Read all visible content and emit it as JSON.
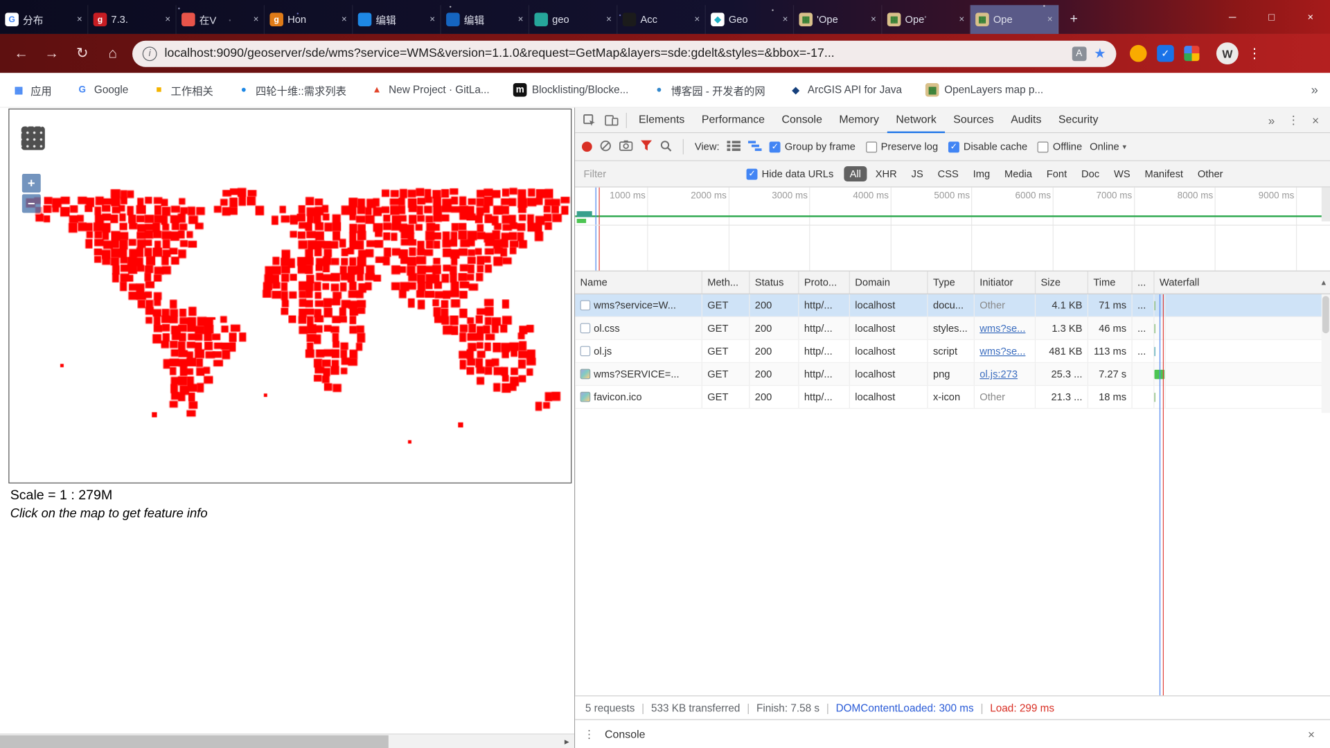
{
  "icons": {
    "back": "←",
    "forward": "→",
    "reload": "↻",
    "home": "⌂",
    "info": "i",
    "translate": "A",
    "star": "★",
    "menu": "⋮",
    "caret": "▾",
    "arrow_right": "▸"
  },
  "window": {
    "tabs": [
      {
        "title": "分布",
        "icon": {
          "name": "google-favicon",
          "bg": "#ffffff",
          "fg": "#4285F4",
          "char": "G"
        },
        "close": "×"
      },
      {
        "title": "7.3.",
        "icon": {
          "name": "gitee-favicon",
          "bg": "#c71d23",
          "fg": "#ffffff",
          "char": "g"
        },
        "close": "×"
      },
      {
        "title": "在V",
        "icon": {
          "name": "site-favicon",
          "bg": "#e8544a",
          "fg": "#ffffff",
          "char": ""
        },
        "close": "×"
      },
      {
        "title": "Hon",
        "icon": {
          "name": "git-favicon",
          "bg": "#df7b18",
          "fg": "#ffffff",
          "char": "g"
        },
        "close": "×"
      },
      {
        "title": "编辑",
        "icon": {
          "name": "editor-favicon",
          "bg": "#1e88e5",
          "fg": "#ffffff",
          "char": ""
        },
        "close": "×"
      },
      {
        "title": "编辑",
        "icon": {
          "name": "editor-favicon",
          "bg": "#1565c0",
          "fg": "#ffffff",
          "char": ""
        },
        "close": "×"
      },
      {
        "title": "geo",
        "icon": {
          "name": "geo-favicon",
          "bg": "#26a69a",
          "fg": "#ffffff",
          "char": ""
        },
        "close": "×"
      },
      {
        "title": "Acc",
        "icon": {
          "name": "dark-favicon",
          "bg": "#1b1b1b",
          "fg": "#ffffff",
          "char": ""
        },
        "close": "×"
      },
      {
        "title": "Geo",
        "icon": {
          "name": "geoserver-favicon",
          "bg": "#ffffff",
          "fg": "#1fb0c4",
          "char": "◆"
        },
        "close": "×"
      },
      {
        "title": "'Ope",
        "icon": {
          "name": "openlayers-favicon",
          "bg": "#d9c08a",
          "fg": "#2e7d32",
          "char": "▦"
        },
        "close": "×"
      },
      {
        "title": "Ope",
        "icon": {
          "name": "openlayers-favicon",
          "bg": "#d9c08a",
          "fg": "#2e7d32",
          "char": "▦"
        },
        "close": "×"
      },
      {
        "title": "Ope",
        "icon": {
          "name": "openlayers-favicon",
          "bg": "#d9c08a",
          "fg": "#2e7d32",
          "char": "▦"
        },
        "active": true,
        "close": "×"
      }
    ],
    "new_tab": "+",
    "minimize": "─",
    "maximize": "□",
    "close": "×"
  },
  "toolbar": {
    "url": "localhost:9090/geoserver/sde/wms?service=WMS&version=1.1.0&request=GetMap&layers=sde:gdelt&styles=&bbox=-17...",
    "profile_initial": "W"
  },
  "bookmarks": {
    "items": [
      {
        "label": "应用",
        "icon": {
          "name": "apps-grid-icon",
          "bg": "#ffffff",
          "fg": "#4285F4",
          "char": "▦"
        }
      },
      {
        "label": "Google",
        "icon": {
          "name": "google-icon",
          "bg": "#ffffff",
          "fg": "#4285F4",
          "char": "G"
        }
      },
      {
        "label": "工作相关",
        "icon": {
          "name": "folder-icon",
          "bg": "#ffffff",
          "fg": "#f4b400",
          "char": "■"
        }
      },
      {
        "label": "四轮十维::需求列表",
        "icon": {
          "name": "site-icon",
          "bg": "#ffffff",
          "fg": "#1e88e5",
          "char": "●"
        }
      },
      {
        "label": "New Project · GitLa...",
        "icon": {
          "name": "gitlab-icon",
          "bg": "#ffffff",
          "fg": "#e24329",
          "char": "▲"
        }
      },
      {
        "label": "Blocklisting/Blocke...",
        "icon": {
          "name": "m-icon",
          "bg": "#111111",
          "fg": "#ffffff",
          "char": "m"
        }
      },
      {
        "label": "博客园 - 开发者的网",
        "icon": {
          "name": "cnblogs-icon",
          "bg": "#ffffff",
          "fg": "#3388cc",
          "char": "●"
        }
      },
      {
        "label": "ArcGIS API for Java",
        "icon": {
          "name": "arcgis-icon",
          "bg": "#ffffff",
          "fg": "#16407c",
          "char": "◆"
        }
      },
      {
        "label": "OpenLayers map p...",
        "icon": {
          "name": "openlayers-icon",
          "bg": "#d9c08a",
          "fg": "#2e7d32",
          "char": "▦"
        }
      }
    ],
    "overflow": "»"
  },
  "map": {
    "zoom_in": "+",
    "zoom_out": "−",
    "scale_text": "Scale = 1 : 279M",
    "hint_text": "Click on the map to get feature info",
    "point_color": "#ff0000",
    "land_rows": [
      [
        [
          12,
          14
        ],
        [
          23,
          28
        ],
        [
          44,
          52
        ],
        [
          55,
          63
        ]
      ],
      [
        [
          2,
          6
        ],
        [
          8,
          20
        ],
        [
          23,
          28
        ],
        [
          33,
          36
        ],
        [
          40,
          65
        ]
      ],
      [
        [
          2,
          7
        ],
        [
          9,
          22
        ],
        [
          24,
          27
        ],
        [
          29,
          29
        ],
        [
          32,
          37
        ],
        [
          39,
          65
        ]
      ],
      [
        [
          3,
          8
        ],
        [
          9,
          21
        ],
        [
          31,
          32
        ],
        [
          33,
          38
        ],
        [
          40,
          64
        ]
      ],
      [
        [
          7,
          22
        ],
        [
          31,
          32
        ],
        [
          34,
          38
        ],
        [
          40,
          63
        ]
      ],
      [
        [
          8,
          21
        ],
        [
          33,
          44
        ],
        [
          45,
          62
        ]
      ],
      [
        [
          9,
          21
        ],
        [
          33,
          43
        ],
        [
          45,
          60
        ]
      ],
      [
        [
          10,
          20
        ],
        [
          32,
          42
        ],
        [
          44,
          59
        ]
      ],
      [
        [
          10,
          19
        ],
        [
          31,
          41
        ],
        [
          43,
          58
        ]
      ],
      [
        [
          11,
          18
        ],
        [
          30,
          42
        ],
        [
          44,
          56
        ]
      ],
      [
        [
          12,
          17
        ],
        [
          30,
          43
        ],
        [
          45,
          55
        ]
      ],
      [
        [
          13,
          17
        ],
        [
          30,
          42
        ],
        [
          45,
          50
        ],
        [
          51,
          54
        ]
      ],
      [
        [
          14,
          18
        ],
        [
          30,
          41
        ],
        [
          46,
          49
        ],
        [
          50,
          53
        ]
      ],
      [
        [
          15,
          19
        ],
        [
          31,
          41
        ],
        [
          46,
          48
        ],
        [
          50,
          52
        ],
        [
          56,
          58
        ]
      ],
      [
        [
          16,
          22
        ],
        [
          32,
          41
        ],
        [
          47,
          48
        ],
        [
          50,
          53
        ],
        [
          55,
          57
        ]
      ],
      [
        [
          16,
          25
        ],
        [
          33,
          41
        ],
        [
          50,
          52
        ],
        [
          54,
          58
        ]
      ],
      [
        [
          17,
          26
        ],
        [
          34,
          41
        ],
        [
          51,
          58
        ],
        [
          60,
          61
        ]
      ],
      [
        [
          17,
          27
        ],
        [
          34,
          41
        ],
        [
          53,
          56
        ],
        [
          59,
          60
        ]
      ],
      [
        [
          18,
          26
        ],
        [
          35,
          41
        ],
        [
          54,
          60
        ]
      ],
      [
        [
          18,
          25
        ],
        [
          35,
          40
        ],
        [
          53,
          61
        ]
      ],
      [
        [
          18,
          24
        ],
        [
          36,
          40
        ],
        [
          53,
          61
        ]
      ],
      [
        [
          19,
          23
        ],
        [
          36,
          39
        ],
        [
          54,
          61
        ]
      ],
      [
        [
          19,
          23
        ],
        [
          36,
          38
        ],
        [
          55,
          60
        ]
      ],
      [
        [
          19,
          22
        ],
        [
          37,
          38
        ],
        [
          57,
          59
        ]
      ],
      [
        [
          19,
          21
        ],
        [
          63,
          64
        ]
      ],
      [
        [
          19,
          21
        ],
        [
          62,
          63
        ]
      ],
      [
        [
          20,
          21
        ]
      ],
      []
    ],
    "scatter": [
      [
        168,
        357,
        6
      ],
      [
        529,
        369,
        6
      ],
      [
        60,
        300,
        4
      ],
      [
        300,
        335,
        4
      ],
      [
        640,
        335,
        4
      ],
      [
        240,
        245,
        3
      ],
      [
        470,
        390,
        4
      ]
    ]
  },
  "devtools": {
    "main_tabs": [
      {
        "label": "Elements"
      },
      {
        "label": "Performance"
      },
      {
        "label": "Console"
      },
      {
        "label": "Memory"
      },
      {
        "label": "Network",
        "active": true
      },
      {
        "label": "Sources"
      },
      {
        "label": "Audits"
      },
      {
        "label": "Security"
      }
    ],
    "more_tabs": "»",
    "menu": "⋮",
    "close": "×",
    "network_toolbar": {
      "view_label": "View:",
      "checkboxes": [
        {
          "label": "Group by frame",
          "checked": true
        },
        {
          "label": "Preserve log",
          "checked": false
        },
        {
          "label": "Disable cache",
          "checked": true
        },
        {
          "label": "Offline",
          "checked": false
        }
      ],
      "throttling": "Online"
    },
    "filter_bar": {
      "placeholder": "Filter",
      "hide_data_urls": {
        "label": "Hide data URLs",
        "checked": true
      },
      "types": [
        {
          "label": "All",
          "active": true
        },
        {
          "label": "XHR"
        },
        {
          "label": "JS"
        },
        {
          "label": "CSS"
        },
        {
          "label": "Img"
        },
        {
          "label": "Media"
        },
        {
          "label": "Font"
        },
        {
          "label": "Doc"
        },
        {
          "label": "WS"
        },
        {
          "label": "Manifest"
        },
        {
          "label": "Other"
        }
      ]
    },
    "timeline": {
      "ticks": [
        "1000 ms",
        "2000 ms",
        "3000 ms",
        "4000 ms",
        "5000 ms",
        "6000 ms",
        "7000 ms",
        "8000 ms",
        "9000 ms"
      ]
    },
    "table": {
      "columns": [
        "Name",
        "Meth...",
        "Status",
        "Proto...",
        "Domain",
        "Type",
        "Initiator",
        "Size",
        "Time",
        "...",
        "Waterfall"
      ],
      "sort_indicator": "▲",
      "rows": [
        {
          "name": "wms?service=W...",
          "method": "GET",
          "status": "200",
          "protocol": "http/...",
          "domain": "localhost",
          "type": "docu...",
          "initiator": "Other",
          "size": "4.1 KB",
          "time": "71 ms",
          "dots": "...",
          "selected": true,
          "img": false,
          "link": false,
          "wf": {
            "left": "1%",
            "width": "1.6%",
            "color": "#74b266"
          }
        },
        {
          "name": "ol.css",
          "method": "GET",
          "status": "200",
          "protocol": "http/...",
          "domain": "localhost",
          "type": "styles...",
          "initiator": "wms?se...",
          "size": "1.3 KB",
          "time": "46 ms",
          "dots": "...",
          "selected": false,
          "img": false,
          "link": true,
          "wf": {
            "left": "1%",
            "width": "1%",
            "color": "#74b266"
          }
        },
        {
          "name": "ol.js",
          "method": "GET",
          "status": "200",
          "protocol": "http/...",
          "domain": "localhost",
          "type": "script",
          "initiator": "wms?se...",
          "size": "481 KB",
          "time": "113 ms",
          "dots": "...",
          "selected": false,
          "img": false,
          "link": true,
          "wf": {
            "left": "1.2%",
            "width": "2.4%",
            "color": "#3f9fae"
          }
        },
        {
          "name": "wms?SERVICE=...",
          "method": "GET",
          "status": "200",
          "protocol": "http/...",
          "domain": "localhost",
          "type": "png",
          "initiator": "ol.js:273",
          "size": "25.3 ...",
          "time": "7.27 s",
          "dots": "",
          "selected": false,
          "img": true,
          "link": true,
          "wf": {
            "left": "3.4%",
            "width": "96.6%",
            "color": "#4cc552"
          }
        },
        {
          "name": "favicon.ico",
          "method": "GET",
          "status": "200",
          "protocol": "http/...",
          "domain": "localhost",
          "type": "x-icon",
          "initiator": "Other",
          "size": "21.3 ...",
          "time": "18 ms",
          "dots": "",
          "selected": false,
          "img": true,
          "link": false,
          "wf": {
            "left": "1%",
            "width": "1.4%",
            "color": "#74b266"
          }
        }
      ]
    },
    "summary": {
      "requests": "5 requests",
      "transferred": "533 KB transferred",
      "finish": "Finish: 7.58 s",
      "dom_content_loaded": "DOMContentLoaded: 300 ms",
      "load": "Load: 299 ms",
      "sep": "|"
    },
    "drawer": {
      "menu": "⋮",
      "label": "Console",
      "close": "×"
    }
  }
}
